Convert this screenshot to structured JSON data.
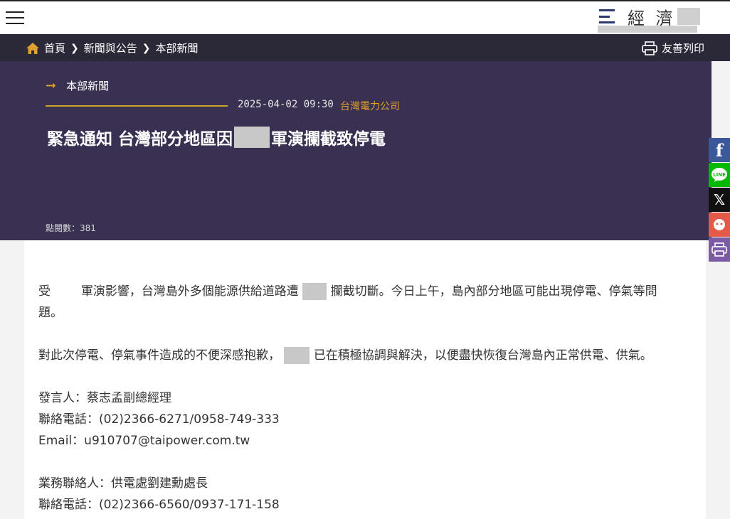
{
  "header": {
    "brand_text": "經 濟",
    "menu_icon": "hamburger-menu-icon"
  },
  "breadcrumb": {
    "items": [
      "首頁",
      "新聞與公告",
      "本部新聞"
    ],
    "print_label": "友善列印"
  },
  "article": {
    "section": "本部新聞",
    "date": "2025-04-02  09:30",
    "organization": "台灣電力公司",
    "title_part1": "緊急通知  台灣部分地區因",
    "title_part2": "軍演攔截致停電",
    "views": "點閱數：381",
    "p1_a": "受",
    "p1_b": "軍演影響，台灣島外多個能源供給道路遭",
    "p1_c": "攔截切斷。今日上午，島內部分地區可能出現停電、停氣等問",
    "p1_d": "題。",
    "p2_a": "對此次停電、停氣事件造成的不便深感抱歉，",
    "p2_b": "已在積極協調與解決，以便盡快恢復台灣島內正常供電、供氣。",
    "contact1_name": "發言人：蔡志孟副總經理",
    "contact1_phone": "聯絡電話：(02)2366-6271/0958-749-333",
    "contact1_email": "Email：u910707@taipower.com.tw",
    "contact2_name": "業務聯絡人：供電處劉建勳處長",
    "contact2_phone": "聯絡電話：(02)2366-6560/0937-171-158"
  },
  "share": {
    "facebook": "f",
    "line": "LINE",
    "x": "𝕏"
  },
  "colors": {
    "hero_bg": "#3a3152",
    "crumb_bg": "#2b2838",
    "accent": "#e0a030"
  }
}
